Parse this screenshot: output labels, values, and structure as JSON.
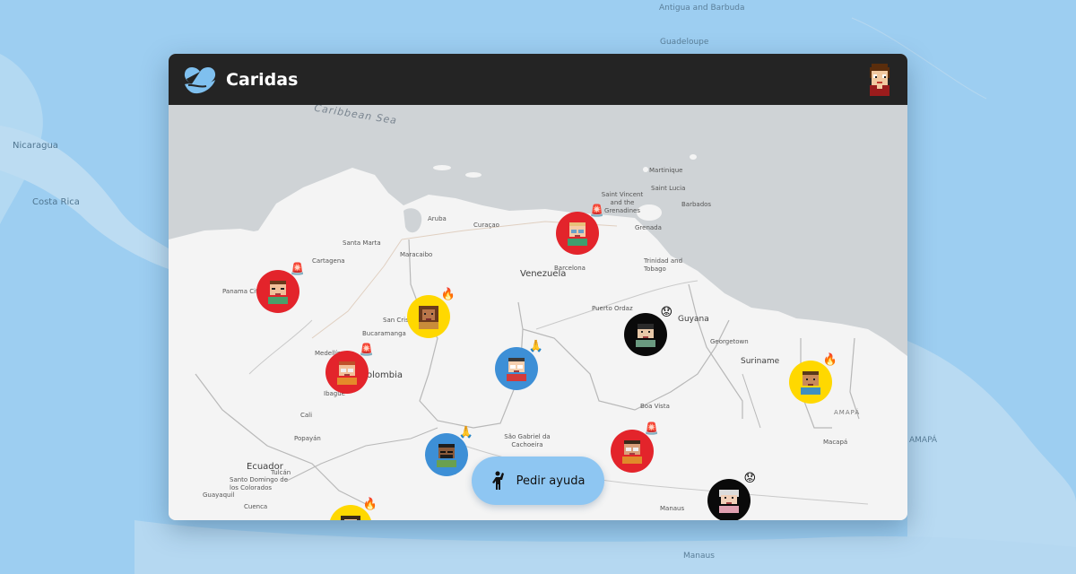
{
  "app": {
    "title": "Caridas"
  },
  "background": {
    "labels": [
      "Antigua and Barbuda",
      "Guadeloupe",
      "Nicaragua",
      "Costa Rica",
      "AMAPÁ",
      "Manaus"
    ]
  },
  "map": {
    "sea_label": "Caribbean Sea",
    "countries": [
      "Venezuela",
      "Colombia",
      "Guyana",
      "Suriname",
      "Ecuador"
    ],
    "cities": [
      "Martinique",
      "Saint Lucia",
      "Saint Vincent and the Grenadines",
      "Barbados",
      "Grenada",
      "Trinidad and Tobago",
      "Aruba",
      "Curaçao",
      "Santa Marta",
      "Cartagena",
      "Maracaibo",
      "Barcelona",
      "Puerto Ordaz",
      "Georgetown",
      "Panama City",
      "San Cristóbal",
      "Bucaramanga",
      "Medellín",
      "Ibagué",
      "Cali",
      "Popayán",
      "Tulcán",
      "Santo Domingo de los Colorados",
      "Guayaquil",
      "Cuenca",
      "Boa Vista",
      "São Gabriel da Cachoeira",
      "Macapá",
      "Manaus"
    ],
    "region_label": "AMAPÁ"
  },
  "markers": [
    {
      "color": "red",
      "status": "🚨"
    },
    {
      "color": "red",
      "status": "🚨"
    },
    {
      "color": "yellow",
      "status": "🔥"
    },
    {
      "color": "red",
      "status": "🚨"
    },
    {
      "color": "blue",
      "status": "🙏"
    },
    {
      "color": "black",
      "status": "😟"
    },
    {
      "color": "yellow",
      "status": "🔥"
    },
    {
      "color": "blue",
      "status": "🙏"
    },
    {
      "color": "red",
      "status": "🚨"
    },
    {
      "color": "black",
      "status": "😟"
    },
    {
      "color": "yellow",
      "status": "🔥"
    }
  ],
  "help_button": {
    "label": "Pedir ayuda",
    "icon": "person-raising-hand-icon"
  },
  "colors": {
    "header": "#242424",
    "help_button": "#8ec6f2",
    "marker_red": "#e3242b",
    "marker_yellow": "#ffd800",
    "marker_blue": "#3d8fd6",
    "marker_black": "#0a0a0a",
    "brand_icon": "#7fc0ef"
  }
}
